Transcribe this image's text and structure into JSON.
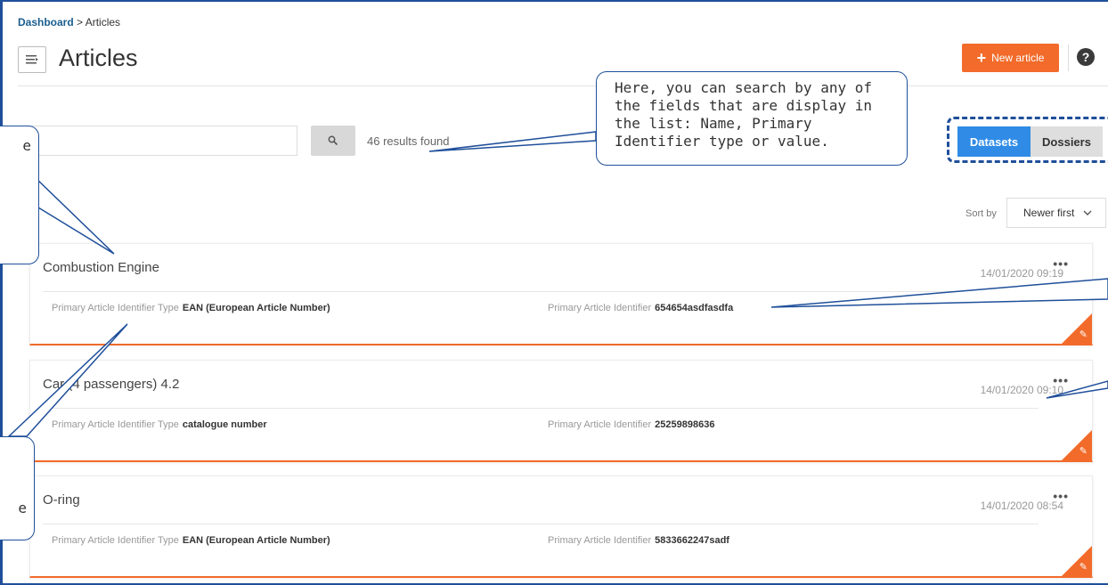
{
  "breadcrumb": {
    "home": "Dashboard",
    "separator": " > ",
    "current": "Articles"
  },
  "header": {
    "title": "Articles",
    "menu_icon": "menu-icon",
    "new_button": "New article",
    "help": "?"
  },
  "search": {
    "placeholder": "",
    "value": "",
    "results": "46 results found"
  },
  "toggle": {
    "datasets": "Datasets",
    "dossiers": "Dossiers",
    "active": "Datasets"
  },
  "sort": {
    "label": "Sort by",
    "value": "Newer first"
  },
  "labels": {
    "type": "Primary Article Identifier Type",
    "identifier": "Primary Article Identifier"
  },
  "articles": [
    {
      "name": "Combustion Engine",
      "date": "14/01/2020 09:19",
      "type": "EAN (European Article Number)",
      "identifier": "654654asdfasdfa"
    },
    {
      "name": "Car (4 passengers) 4.2",
      "date": "14/01/2020 09:10",
      "type": "catalogue number",
      "identifier": "25259898636"
    },
    {
      "name": "O-ring",
      "date": "14/01/2020 08:54",
      "type": "EAN (European Article Number)",
      "identifier": "5833662247sadf"
    }
  ],
  "callouts": {
    "main": "Here, you can search by any of the fields that are display in the list: Name, Primary Identifier type or value.",
    "left_top": "e",
    "left_bottom": "e"
  },
  "colors": {
    "accent": "#f26b2a",
    "link": "#1a5e8f",
    "toggle_active": "#2f8be6",
    "callout_border": "#1f4f9a"
  }
}
